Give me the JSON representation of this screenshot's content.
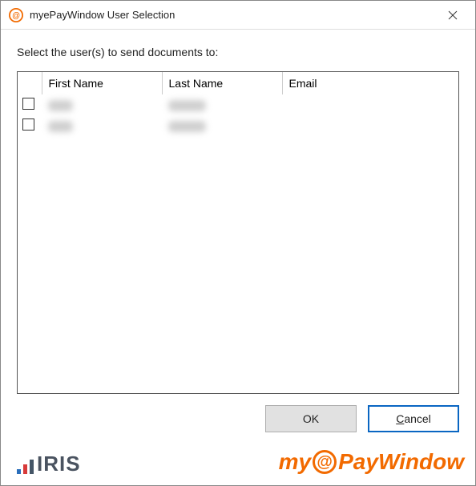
{
  "window": {
    "title": "myePayWindow User Selection"
  },
  "instruction": "Select the user(s) to send documents to:",
  "table": {
    "columns": {
      "first_name": "First Name",
      "last_name": "Last Name",
      "email": "Email"
    },
    "rows": [
      {
        "checked": false,
        "first_name": "David",
        "last_name": "Bloxham",
        "email": ""
      },
      {
        "checked": false,
        "first_name": "David",
        "last_name": "Bloxham",
        "email": ""
      }
    ]
  },
  "buttons": {
    "ok": "OK",
    "cancel": "Cancel"
  },
  "footer": {
    "iris_label": "IRIS",
    "mypw_prefix": "my",
    "mypw_at": "@",
    "mypw_suffix": "PayWindow"
  }
}
